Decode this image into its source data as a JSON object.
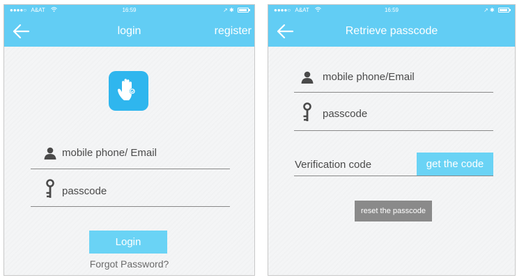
{
  "status_bar": {
    "signal": "●●●●○",
    "carrier": "A&AT",
    "wifi_icon": "wifi-icon",
    "time": "16:59",
    "right_icons": "↗ ✱"
  },
  "login_screen": {
    "nav": {
      "back_icon": "back-arrow-icon",
      "title": "login",
      "register_label": "register"
    },
    "logo_icon": "hand-logo-icon",
    "username_label": "mobile phone/ Email",
    "password_label": "passcode",
    "login_button": "Login",
    "forgot_link": "Forgot Password?"
  },
  "retrieve_screen": {
    "nav": {
      "back_icon": "back-arrow-icon",
      "title": "Retrieve passcode"
    },
    "username_label": "mobile phone/Email",
    "password_label": "passcode",
    "verification_label": "Verification code",
    "get_code_button": "get the code",
    "reset_button": "reset the passcode"
  },
  "colors": {
    "header": "#62cdf4",
    "button": "#6ad3f5",
    "logo": "#2fb6ee",
    "reset_button": "#8a8a8a",
    "background": "#f4f5f6"
  }
}
